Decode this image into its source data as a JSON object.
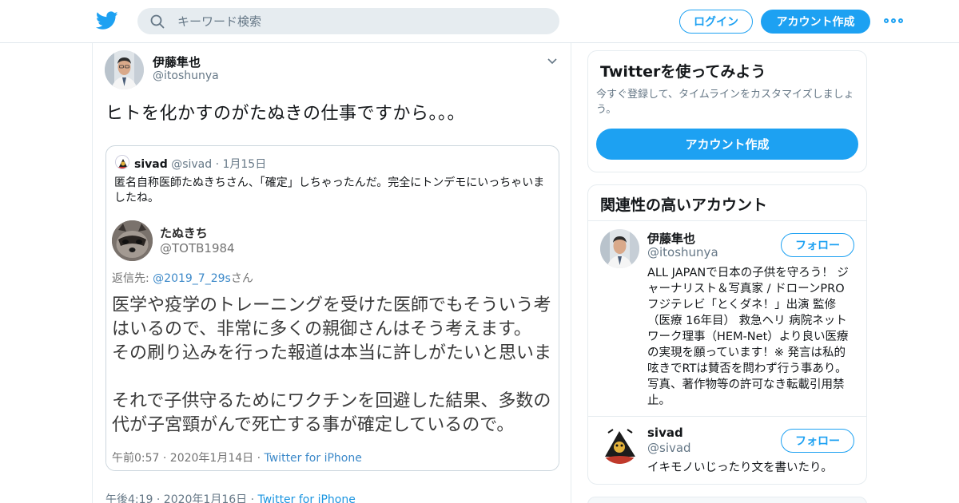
{
  "header": {
    "search_placeholder": "キーワード検索",
    "login_label": "ログイン",
    "signup_label": "アカウント作成"
  },
  "tweet": {
    "author_name": "伊藤隼也",
    "author_handle": "@itoshunya",
    "text": "ヒトを化かすのがたぬきの仕事ですから。。。",
    "timestamp": "午後4:19 · 2020年1月16日",
    "source": "Twitter for iPhone",
    "quoted": {
      "author_name": "sivad",
      "author_handle": "@sivad",
      "date": "1月15日",
      "text": "匿名自称医師たぬきちさん、「確定」しちゃったんだ。完全にトンデモにいっちゃいましたね。",
      "image_tweet": {
        "author_name": "たぬきち",
        "author_handle": "@TOTB1984",
        "reply_prefix": "返信先: ",
        "reply_to": "@2019_7_29s",
        "reply_suffix": "さん",
        "lines": [
          "医学や疫学のトレーニングを受けた医師でもそういう考",
          "はいるので、非常に多くの親御さんはそう考えます。",
          "その刷り込みを行った報道は本当に許しがたいと思いま",
          "",
          "それで子供守るためにワクチンを回避した結果、多数の",
          "代が子宮頸がんで死亡する事が確定しているので。"
        ],
        "timestamp": "午前0:57 · 2020年1月14日",
        "source": "Twitter for iPhone"
      }
    }
  },
  "sidebar": {
    "try_card": {
      "title": "Twitterを使ってみよう",
      "description": "今すぐ登録して、タイムラインをカスタマイズしましょう。",
      "button_label": "アカウント作成"
    },
    "related": {
      "title": "関連性の高いアカウント",
      "accounts": [
        {
          "name": "伊藤隼也",
          "handle": "@itoshunya",
          "follow_label": "フォロー",
          "bio": "ALL JAPANで日本の子供を守ろう！ ジャーナリスト＆写真家 / ドローンPRO フジテレビ「とくダネ！」出演 監修（医療 16年目） 救急ヘリ 病院ネットワーク理事（HEM-Net）より良い医療の実現を願っています！※ 発言は私的呟きでRTは賛否を問わず行う事あり。写真、著作物等の許可なき転載引用禁止。"
        },
        {
          "name": "sivad",
          "handle": "@sivad",
          "follow_label": "フォロー",
          "bio": "イキモノいじったり文を書いたり。"
        }
      ]
    }
  },
  "colors": {
    "accent": "#1da1f2",
    "muted": "#657786",
    "border": "#e6ecf0"
  }
}
